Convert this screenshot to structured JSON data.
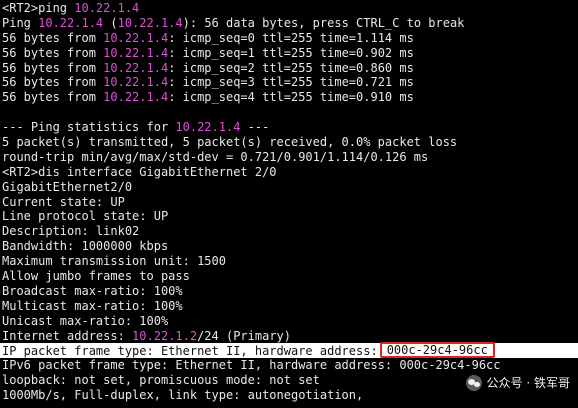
{
  "terminal": {
    "lines": [
      {
        "segments": [
          {
            "text": "<RT2>ping "
          },
          {
            "text": "10.22.1.4",
            "ip": true
          }
        ]
      },
      {
        "segments": [
          {
            "text": "Ping "
          },
          {
            "text": "10.22.1.4",
            "ip": true
          },
          {
            "text": " ("
          },
          {
            "text": "10.22.1.4",
            "ip": true
          },
          {
            "text": "): 56 data bytes, press CTRL_C to break"
          }
        ]
      },
      {
        "segments": [
          {
            "text": "56 bytes from "
          },
          {
            "text": "10.22.1.4",
            "ip": true
          },
          {
            "text": ": icmp_seq=0 ttl=255 time=1.114 ms"
          }
        ]
      },
      {
        "segments": [
          {
            "text": "56 bytes from "
          },
          {
            "text": "10.22.1.4",
            "ip": true
          },
          {
            "text": ": icmp_seq=1 ttl=255 time=0.902 ms"
          }
        ]
      },
      {
        "segments": [
          {
            "text": "56 bytes from "
          },
          {
            "text": "10.22.1.4",
            "ip": true
          },
          {
            "text": ": icmp_seq=2 ttl=255 time=0.860 ms"
          }
        ]
      },
      {
        "segments": [
          {
            "text": "56 bytes from "
          },
          {
            "text": "10.22.1.4",
            "ip": true
          },
          {
            "text": ": icmp_seq=3 ttl=255 time=0.721 ms"
          }
        ]
      },
      {
        "segments": [
          {
            "text": "56 bytes from "
          },
          {
            "text": "10.22.1.4",
            "ip": true
          },
          {
            "text": ": icmp_seq=4 ttl=255 time=0.910 ms"
          }
        ]
      },
      {
        "segments": [
          {
            "text": ""
          }
        ]
      },
      {
        "segments": [
          {
            "text": "--- Ping statistics for "
          },
          {
            "text": "10.22.1.4",
            "ip": true
          },
          {
            "text": " ---"
          }
        ]
      },
      {
        "segments": [
          {
            "text": "5 packet(s) transmitted, 5 packet(s) received, 0.0% packet loss"
          }
        ]
      },
      {
        "segments": [
          {
            "text": "round-trip min/avg/max/std-dev = 0.721/0.901/1.114/0.126 ms"
          }
        ]
      },
      {
        "segments": [
          {
            "text": "<RT2>dis interface GigabitEthernet 2/0"
          }
        ]
      },
      {
        "segments": [
          {
            "text": "GigabitEthernet2/0"
          }
        ]
      },
      {
        "segments": [
          {
            "text": "Current state: UP"
          }
        ]
      },
      {
        "segments": [
          {
            "text": "Line protocol state: UP"
          }
        ]
      },
      {
        "segments": [
          {
            "text": "Description: link02"
          }
        ]
      },
      {
        "segments": [
          {
            "text": "Bandwidth: 1000000 kbps"
          }
        ]
      },
      {
        "segments": [
          {
            "text": "Maximum transmission unit: 1500"
          }
        ]
      },
      {
        "segments": [
          {
            "text": "Allow jumbo frames to pass"
          }
        ]
      },
      {
        "segments": [
          {
            "text": "Broadcast max-ratio: 100%"
          }
        ]
      },
      {
        "segments": [
          {
            "text": "Multicast max-ratio: 100%"
          }
        ]
      },
      {
        "segments": [
          {
            "text": "Unicast max-ratio: 100%"
          }
        ]
      },
      {
        "segments": [
          {
            "text": "Internet address: "
          },
          {
            "text": "10.22.1.2",
            "ip": true
          },
          {
            "text": "/24 (Primary)"
          }
        ]
      },
      {
        "highlight": true,
        "segments": [
          {
            "text": "IP packet frame type: Ethernet II, hardware address:"
          },
          {
            "text": "000c-29c4-96cc",
            "boxed": true
          }
        ]
      },
      {
        "segments": [
          {
            "text": "IPv6 packet frame type: Ethernet II, hardware address: 000c-29c4-96cc"
          }
        ]
      },
      {
        "segments": [
          {
            "text": "loopback: not set, promiscuous mode: not set"
          }
        ]
      },
      {
        "segments": [
          {
            "text": "1000Mb/s, Full-duplex, link type: autonegotiation,"
          }
        ]
      }
    ]
  },
  "watermark": {
    "icon": "wechat-icon",
    "text": "公众号 · 铁军哥"
  },
  "colors": {
    "background": "#000000",
    "text": "#e8e8e8",
    "ip": "#e04fd6",
    "highlight_bg": "#ffffff",
    "box_border": "#e0231c"
  }
}
